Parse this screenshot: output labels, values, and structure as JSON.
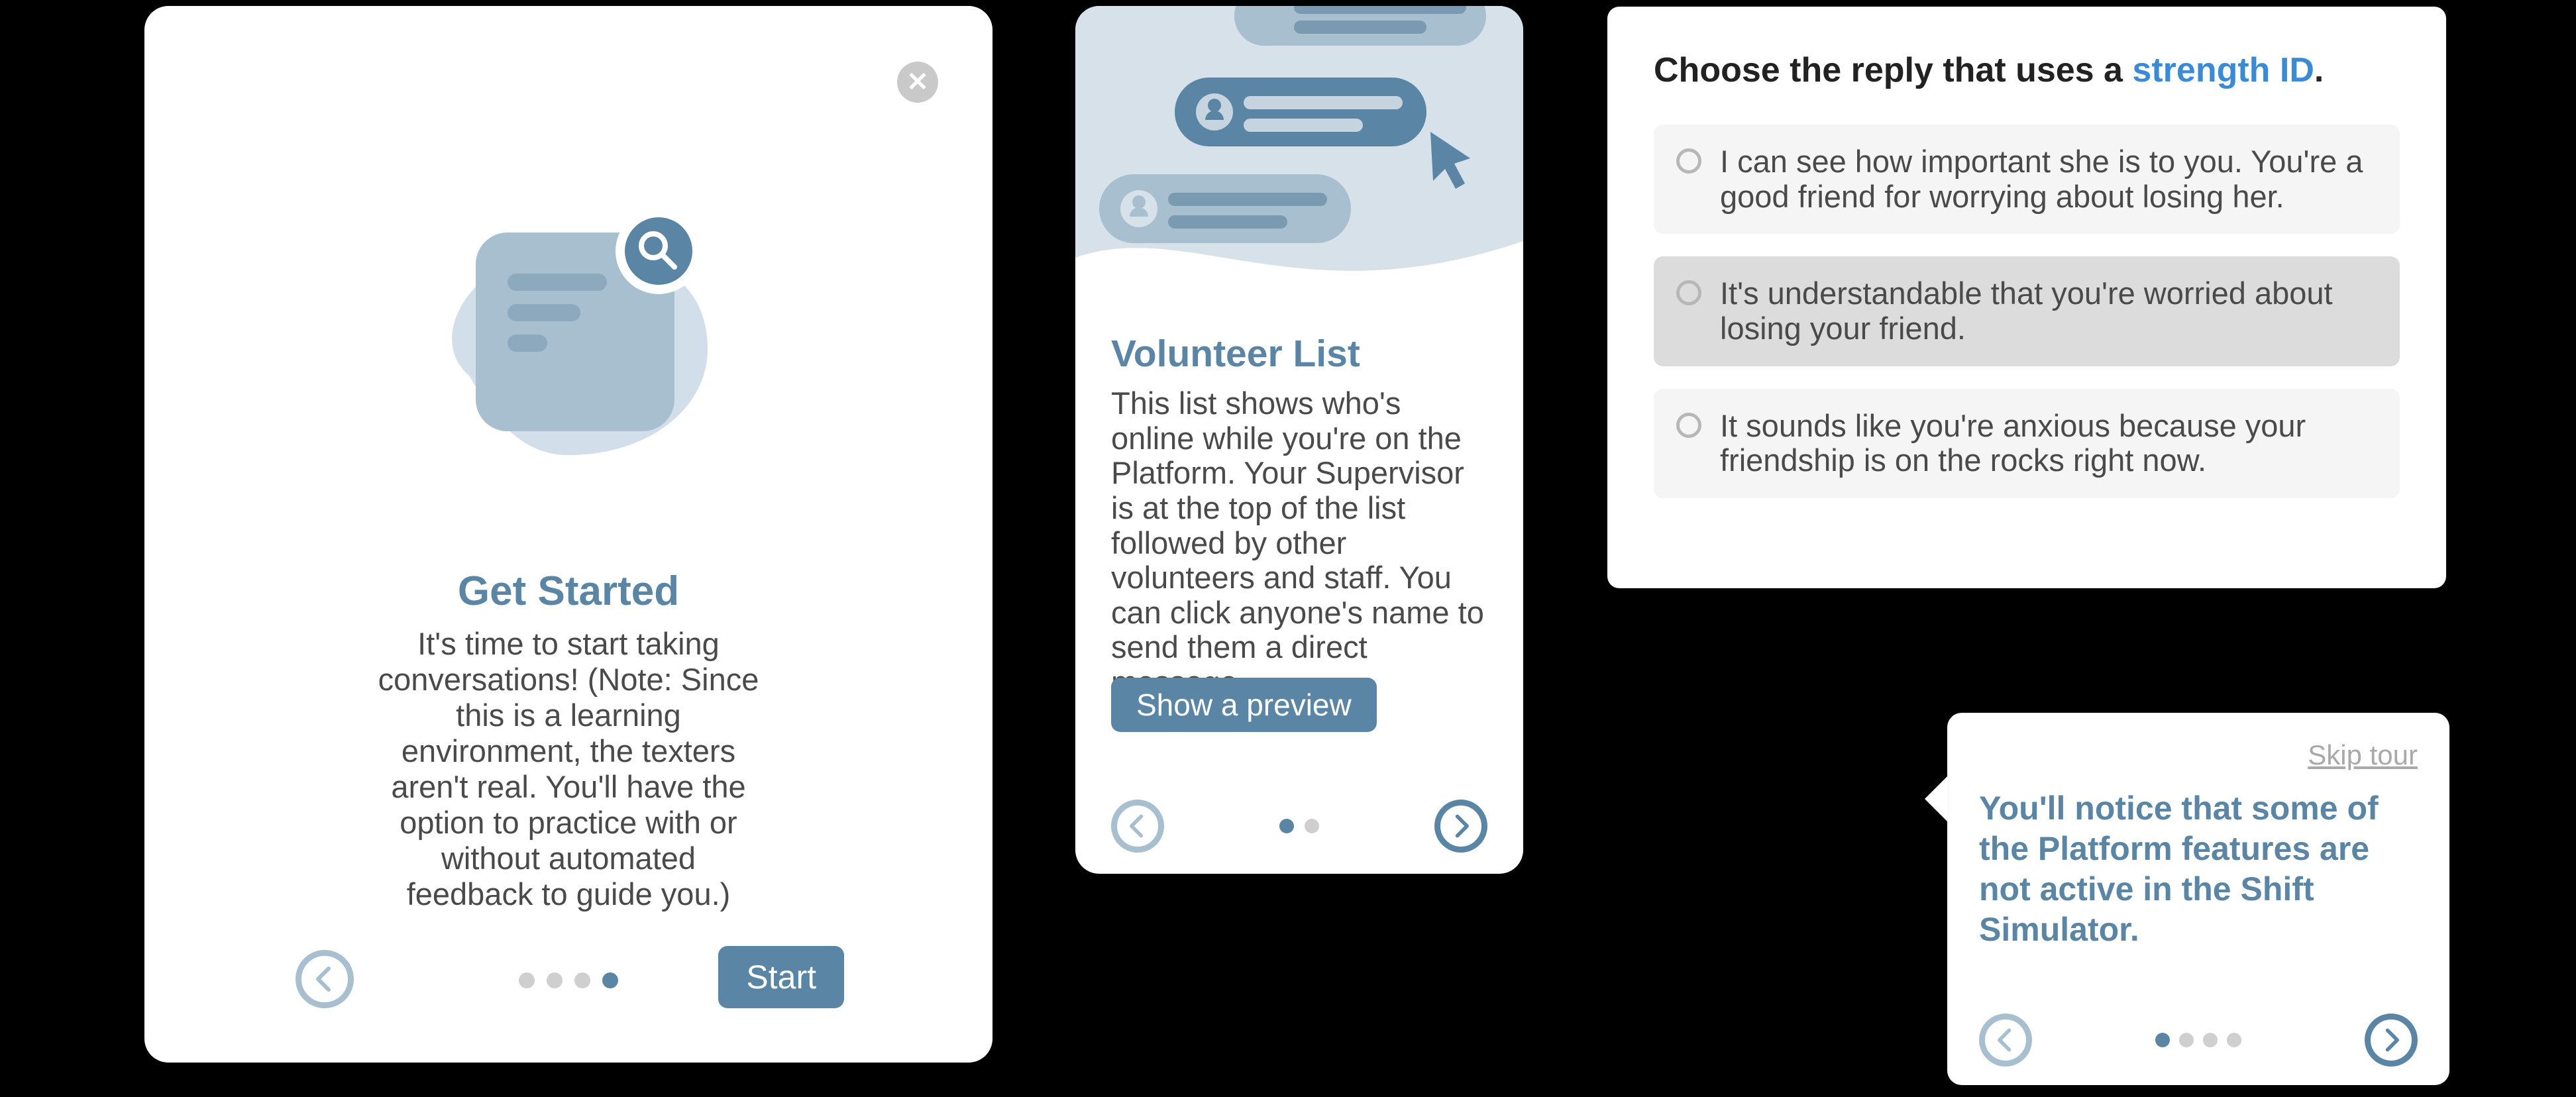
{
  "get_started": {
    "title": "Get Started",
    "body": "It's time to start taking conversations! (Note: Since this is a learning environment, the texters aren't real. You'll have the option to practice with or without automated feedback to guide you.)",
    "start_label": "Start",
    "dots_total": 4,
    "dots_active_index": 3
  },
  "volunteer_list": {
    "title": "Volunteer List",
    "body": "This list shows who's online while you're on the Platform. Your Supervisor is at the top of the list followed by other volunteers and staff. You can click anyone's name to send them a direct message.",
    "preview_label": "Show a preview",
    "dots_total": 2,
    "dots_active_index": 0
  },
  "quiz": {
    "prompt_prefix": "Choose the reply that uses a ",
    "prompt_highlight": "strength ID",
    "prompt_suffix": ".",
    "choices": [
      {
        "text": "I can see how important she is to you. You're a good friend for worrying about losing her.",
        "selected": false
      },
      {
        "text": "It's understandable that you're worried about losing your friend.",
        "selected": true
      },
      {
        "text": "It sounds like you're anxious because your friendship is on the rocks right now.",
        "selected": false
      }
    ]
  },
  "tour": {
    "skip_label": "Skip tour",
    "body": "You'll notice that some of the Platform features are not active in the Shift Simulator.",
    "dots_total": 4,
    "dots_active_index": 0
  }
}
